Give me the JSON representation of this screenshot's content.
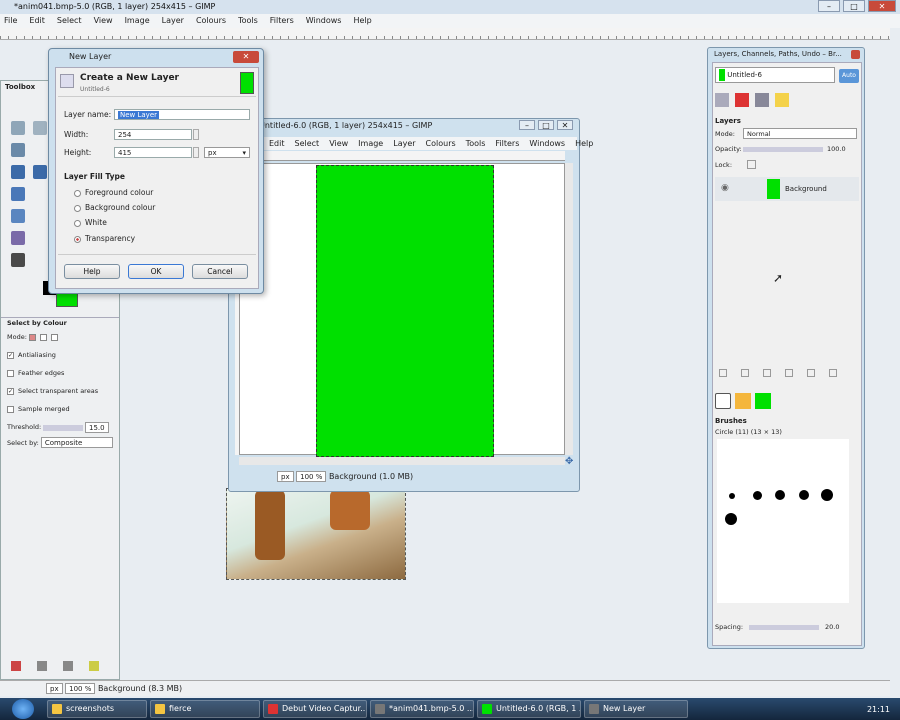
{
  "window": {
    "title": "*anim041.bmp-5.0 (RGB, 1 layer) 254x415 – GIMP"
  },
  "menu": [
    "File",
    "Edit",
    "Select",
    "View",
    "Image",
    "Layer",
    "Colours",
    "Tools",
    "Filters",
    "Windows",
    "Help"
  ],
  "toolbox": {
    "title": "Toolbox",
    "options_title": "Select by Colour",
    "mode_label": "Mode:",
    "antialiasing": "Antialiasing",
    "feather": "Feather edges",
    "select_transparent": "Select transparent areas",
    "sample_merged": "Sample merged",
    "threshold_label": "Threshold:",
    "threshold_value": "15.0",
    "select_by_label": "Select by:",
    "select_by_value": "Composite"
  },
  "image_window": {
    "title": "Untitled-6.0 (RGB, 1 layer) 254x415 – GIMP",
    "menu": [
      "Edit",
      "Select",
      "View",
      "Image",
      "Layer",
      "Colours",
      "Tools",
      "Filters",
      "Windows",
      "Help"
    ],
    "unit": "px",
    "zoom": "100 %",
    "status": "Background (1.0 MB)"
  },
  "dialog": {
    "window_title": "New Layer",
    "heading": "Create a New Layer",
    "subheading": "Untitled-6",
    "layer_name_label": "Layer name:",
    "layer_name_value": "New Layer",
    "width_label": "Width:",
    "width_value": "254",
    "height_label": "Height:",
    "height_value": "415",
    "unit": "px",
    "fill_type_label": "Layer Fill Type",
    "fill_options": [
      "Foreground colour",
      "Background colour",
      "White",
      "Transparency"
    ],
    "help": "Help",
    "ok": "OK",
    "cancel": "Cancel"
  },
  "dock": {
    "title": "Layers, Channels, Paths, Undo – Br...",
    "image_select": "Untitled-6",
    "auto": "Auto",
    "layers_label": "Layers",
    "mode_label": "Mode:",
    "mode_value": "Normal",
    "opacity_label": "Opacity:",
    "opacity_value": "100.0",
    "lock_label": "Lock:",
    "layer_name": "Background",
    "brushes_label": "Brushes",
    "brush_name": "Circle (11) (13 × 13)",
    "spacing_label": "Spacing:",
    "spacing_value": "20.0"
  },
  "main_status": {
    "unit": "px",
    "zoom": "100 %",
    "text": "Background (8.3 MB)"
  },
  "taskbar": {
    "items": [
      "screenshots",
      "fierce",
      "Debut Video Captur...",
      "*anim041.bmp-5.0 ...",
      "Untitled-6.0 (RGB, 1 ...",
      "New Layer"
    ],
    "clock": "21:11"
  },
  "colors": {
    "layer_green": "#00e000",
    "accent_orange": "#f4b63c"
  }
}
